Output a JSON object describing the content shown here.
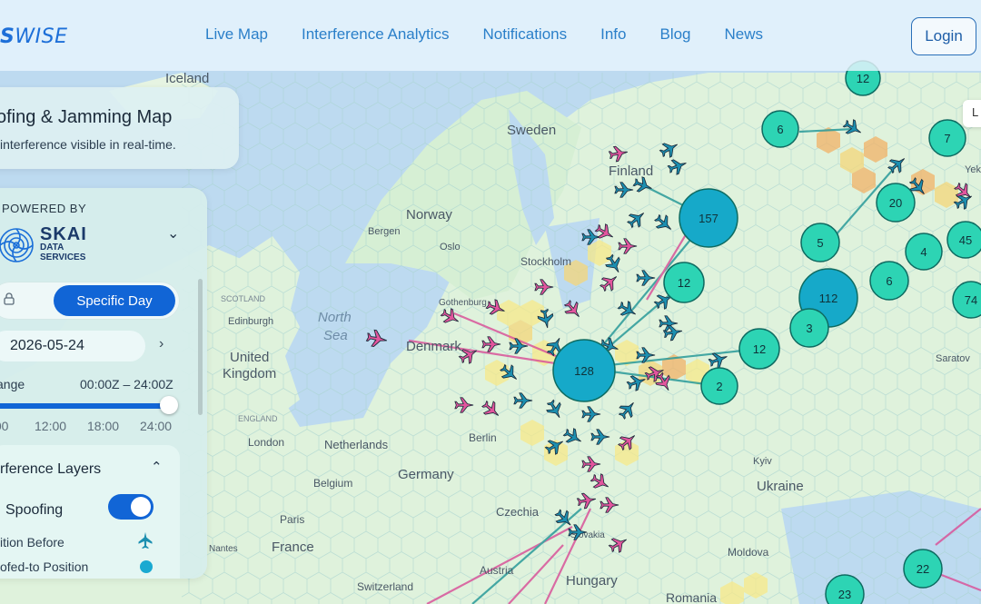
{
  "header": {
    "logo_bold": "S",
    "logo_rest": "WISE",
    "nav": [
      "Live Map",
      "Interference Analytics",
      "Notifications",
      "Info",
      "Blog",
      "News"
    ],
    "login_label": "Login"
  },
  "title_card": {
    "title": "ofing & Jamming Map",
    "subtitle": "interference visible in real-time."
  },
  "panel": {
    "powered_by": "POWERED BY",
    "brand_big": "SKAI",
    "brand_small_1": "DATA",
    "brand_small_2": "SERVICES",
    "mode_active": "Specific Day",
    "date": "2026-05-24",
    "range_label": "ange",
    "range_value": "00:00Z – 24:00Z",
    "ticks": [
      ":00",
      "12:00",
      "18:00",
      "24:00"
    ],
    "layers_title": "rference Layers",
    "spoofing_label": "Spoofing",
    "spoofing_on": true,
    "legend_before": "ition Before",
    "legend_after": "ofed-to Position"
  },
  "tooltip_stub": "L",
  "colors": {
    "accent": "#1165d6",
    "plane_before": "#1c8fb0",
    "plane_after": "#e2559d",
    "cluster": "#2dd4b4",
    "cluster_large": "#16a9c9",
    "land": "#dff2dc",
    "sea": "#bddaf0"
  },
  "map": {
    "places": [
      "Iceland",
      "Sweden",
      "Finland",
      "Norway",
      "Bergen",
      "Oslo",
      "Stockholm",
      "Gothenburg",
      "SCOTLAND",
      "Edinburgh",
      "North",
      "Sea",
      "Denmark",
      "United",
      "Kingdom",
      "ENGLAND",
      "London",
      "Netherlands",
      "Berlin",
      "Germany",
      "Belgium",
      "Czechia",
      "Paris",
      "France",
      "Nantes",
      "Austria",
      "Switzerland",
      "Hungary",
      "Slovakia",
      "Moldova",
      "Romania",
      "Kyiv",
      "Ukraine",
      "Saratov",
      "Yek"
    ],
    "clusters": [
      "12",
      "6",
      "7",
      "157",
      "20",
      "5",
      "4",
      "45",
      "12",
      "6",
      "112",
      "74",
      "3",
      "12",
      "128",
      "2",
      "22",
      "23"
    ]
  }
}
